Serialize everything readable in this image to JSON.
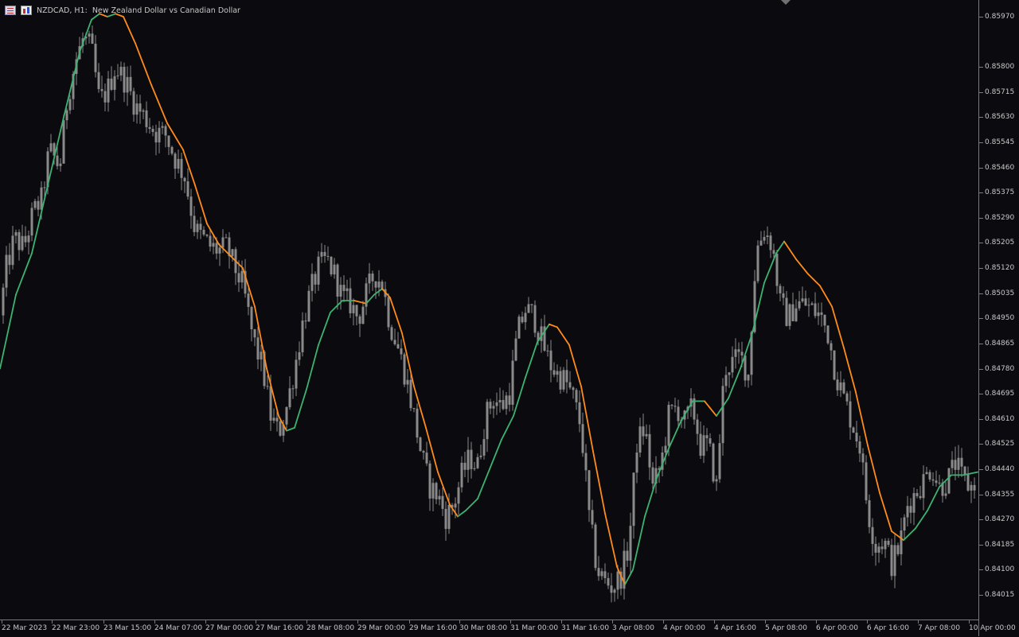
{
  "header": {
    "symbol": "NZDCAD, H1:",
    "description": "New Zealand Dollar vs Canadian Dollar"
  },
  "icons": [
    "list-icon",
    "bar-chart-icon",
    "shift-marker-icon"
  ],
  "colors": {
    "background": "#0b0b0f",
    "candle": "#8a8a8a",
    "ma_up": "#3cb371",
    "ma_down": "#ff8c1a",
    "axis_text": "#c8c8c8"
  },
  "chart_data": {
    "type": "candlestick",
    "xlabel": "",
    "ylabel": "",
    "ylim": [
      0.8397,
      0.86
    ],
    "grid": false,
    "price_ticks": [
      "0.85970",
      "0.85800",
      "0.85715",
      "0.85630",
      "0.85545",
      "0.85460",
      "0.85375",
      "0.85290",
      "0.85205",
      "0.85120",
      "0.85035",
      "0.84950",
      "0.84865",
      "0.84780",
      "0.84695",
      "0.84610",
      "0.84525",
      "0.84440",
      "0.84355",
      "0.84270",
      "0.84185",
      "0.84100",
      "0.84015"
    ],
    "time_ticks": [
      "22 Mar 2023",
      "22 Mar 23:00",
      "23 Mar 15:00",
      "24 Mar 07:00",
      "27 Mar 00:00",
      "27 Mar 16:00",
      "28 Mar 08:00",
      "29 Mar 00:00",
      "29 Mar 16:00",
      "30 Mar 08:00",
      "31 Mar 00:00",
      "31 Mar 16:00",
      "3 Apr 08:00",
      "4 Apr 00:00",
      "4 Apr 16:00",
      "5 Apr 08:00",
      "6 Apr 00:00",
      "6 Apr 16:00",
      "7 Apr 08:00",
      "10 Apr 00:00"
    ],
    "close_path": [
      [
        0,
        0.8496
      ],
      [
        8,
        0.8512
      ],
      [
        18,
        0.8522
      ],
      [
        30,
        0.8519
      ],
      [
        42,
        0.8531
      ],
      [
        52,
        0.8535
      ],
      [
        62,
        0.8552
      ],
      [
        75,
        0.8546
      ],
      [
        85,
        0.857
      ],
      [
        95,
        0.8582
      ],
      [
        105,
        0.859
      ],
      [
        115,
        0.8586
      ],
      [
        125,
        0.8568
      ],
      [
        135,
        0.8572
      ],
      [
        145,
        0.858
      ],
      [
        158,
        0.8575
      ],
      [
        170,
        0.8567
      ],
      [
        182,
        0.8563
      ],
      [
        195,
        0.8558
      ],
      [
        208,
        0.8557
      ],
      [
        220,
        0.8549
      ],
      [
        232,
        0.8543
      ],
      [
        245,
        0.8525
      ],
      [
        255,
        0.8522
      ],
      [
        265,
        0.8519
      ],
      [
        275,
        0.8518
      ],
      [
        285,
        0.8519
      ],
      [
        295,
        0.8512
      ],
      [
        305,
        0.8506
      ],
      [
        318,
        0.8488
      ],
      [
        330,
        0.8478
      ],
      [
        340,
        0.8462
      ],
      [
        350,
        0.8456
      ],
      [
        360,
        0.8465
      ],
      [
        370,
        0.8478
      ],
      [
        380,
        0.8493
      ],
      [
        390,
        0.8504
      ],
      [
        400,
        0.8512
      ],
      [
        410,
        0.8515
      ],
      [
        420,
        0.851
      ],
      [
        430,
        0.8502
      ],
      [
        440,
        0.85
      ],
      [
        450,
        0.8495
      ],
      [
        460,
        0.8503
      ],
      [
        470,
        0.851
      ],
      [
        480,
        0.8507
      ],
      [
        490,
        0.8493
      ],
      [
        500,
        0.8485
      ],
      [
        510,
        0.8475
      ],
      [
        520,
        0.8462
      ],
      [
        530,
        0.8448
      ],
      [
        540,
        0.8438
      ],
      [
        550,
        0.8435
      ],
      [
        560,
        0.8428
      ],
      [
        570,
        0.8432
      ],
      [
        580,
        0.8442
      ],
      [
        590,
        0.8448
      ],
      [
        600,
        0.8445
      ],
      [
        610,
        0.8462
      ],
      [
        620,
        0.8468
      ],
      [
        630,
        0.8465
      ],
      [
        640,
        0.847
      ],
      [
        650,
        0.849
      ],
      [
        660,
        0.8498
      ],
      [
        670,
        0.8496
      ],
      [
        680,
        0.8488
      ],
      [
        690,
        0.848
      ],
      [
        700,
        0.8476
      ],
      [
        710,
        0.8474
      ],
      [
        720,
        0.8468
      ],
      [
        730,
        0.8458
      ],
      [
        740,
        0.8428
      ],
      [
        750,
        0.841
      ],
      [
        760,
        0.8406
      ],
      [
        770,
        0.8404
      ],
      [
        780,
        0.8408
      ],
      [
        790,
        0.8418
      ],
      [
        800,
        0.8453
      ],
      [
        810,
        0.8458
      ],
      [
        820,
        0.8438
      ],
      [
        830,
        0.8445
      ],
      [
        840,
        0.8462
      ],
      [
        850,
        0.8465
      ],
      [
        860,
        0.846
      ],
      [
        870,
        0.8465
      ],
      [
        880,
        0.8452
      ],
      [
        890,
        0.8452
      ],
      [
        900,
        0.8438
      ],
      [
        910,
        0.8478
      ],
      [
        920,
        0.848
      ],
      [
        930,
        0.8482
      ],
      [
        940,
        0.8476
      ],
      [
        950,
        0.8518
      ],
      [
        960,
        0.8525
      ],
      [
        970,
        0.852
      ],
      [
        980,
        0.85
      ],
      [
        990,
        0.8495
      ],
      [
        1000,
        0.85
      ],
      [
        1010,
        0.85
      ],
      [
        1020,
        0.8498
      ],
      [
        1030,
        0.8496
      ],
      [
        1040,
        0.849
      ],
      [
        1050,
        0.8476
      ],
      [
        1060,
        0.8468
      ],
      [
        1070,
        0.846
      ],
      [
        1080,
        0.8452
      ],
      [
        1090,
        0.843
      ],
      [
        1100,
        0.8418
      ],
      [
        1110,
        0.842
      ],
      [
        1120,
        0.8412
      ],
      [
        1130,
        0.8418
      ],
      [
        1140,
        0.8432
      ],
      [
        1150,
        0.8436
      ],
      [
        1160,
        0.844
      ],
      [
        1170,
        0.8445
      ],
      [
        1180,
        0.8438
      ],
      [
        1190,
        0.844
      ],
      [
        1200,
        0.8446
      ],
      [
        1210,
        0.844
      ],
      [
        1220,
        0.8438
      ],
      [
        1228,
        0.8442
      ]
    ],
    "ma_path": [
      [
        0,
        0.8478
      ],
      [
        20,
        0.8503
      ],
      [
        40,
        0.8517
      ],
      [
        60,
        0.854
      ],
      [
        80,
        0.8563
      ],
      [
        100,
        0.8585
      ],
      [
        115,
        0.8596
      ],
      [
        125,
        0.8598
      ],
      [
        135,
        0.8597
      ],
      [
        145,
        0.8598
      ],
      [
        155,
        0.8597
      ],
      [
        170,
        0.8588
      ],
      [
        190,
        0.8574
      ],
      [
        210,
        0.8561
      ],
      [
        230,
        0.8552
      ],
      [
        245,
        0.854
      ],
      [
        260,
        0.8527
      ],
      [
        275,
        0.852
      ],
      [
        290,
        0.8516
      ],
      [
        305,
        0.8512
      ],
      [
        320,
        0.8499
      ],
      [
        335,
        0.8478
      ],
      [
        350,
        0.8462
      ],
      [
        360,
        0.8457
      ],
      [
        370,
        0.8458
      ],
      [
        385,
        0.8471
      ],
      [
        400,
        0.8486
      ],
      [
        415,
        0.8497
      ],
      [
        430,
        0.8501
      ],
      [
        445,
        0.8501
      ],
      [
        460,
        0.85
      ],
      [
        470,
        0.8503
      ],
      [
        480,
        0.8505
      ],
      [
        490,
        0.8502
      ],
      [
        505,
        0.849
      ],
      [
        520,
        0.8472
      ],
      [
        535,
        0.8458
      ],
      [
        550,
        0.8443
      ],
      [
        565,
        0.8432
      ],
      [
        575,
        0.8428
      ],
      [
        585,
        0.843
      ],
      [
        600,
        0.8434
      ],
      [
        615,
        0.8444
      ],
      [
        630,
        0.8454
      ],
      [
        645,
        0.8462
      ],
      [
        660,
        0.8475
      ],
      [
        675,
        0.8487
      ],
      [
        690,
        0.8493
      ],
      [
        700,
        0.8492
      ],
      [
        715,
        0.8486
      ],
      [
        730,
        0.8472
      ],
      [
        745,
        0.845
      ],
      [
        760,
        0.8429
      ],
      [
        775,
        0.8411
      ],
      [
        785,
        0.8405
      ],
      [
        795,
        0.841
      ],
      [
        810,
        0.8428
      ],
      [
        825,
        0.8441
      ],
      [
        840,
        0.8451
      ],
      [
        855,
        0.846
      ],
      [
        870,
        0.8467
      ],
      [
        885,
        0.8467
      ],
      [
        900,
        0.8462
      ],
      [
        915,
        0.8468
      ],
      [
        930,
        0.8478
      ],
      [
        945,
        0.849
      ],
      [
        960,
        0.8507
      ],
      [
        975,
        0.8517
      ],
      [
        985,
        0.8521
      ],
      [
        1000,
        0.8515
      ],
      [
        1015,
        0.851
      ],
      [
        1030,
        0.8506
      ],
      [
        1045,
        0.8499
      ],
      [
        1060,
        0.8485
      ],
      [
        1075,
        0.847
      ],
      [
        1090,
        0.8452
      ],
      [
        1105,
        0.8436
      ],
      [
        1120,
        0.8423
      ],
      [
        1135,
        0.842
      ],
      [
        1150,
        0.8424
      ],
      [
        1165,
        0.843
      ],
      [
        1180,
        0.8438
      ],
      [
        1195,
        0.8442
      ],
      [
        1210,
        0.8442
      ],
      [
        1228,
        0.8443
      ]
    ]
  }
}
